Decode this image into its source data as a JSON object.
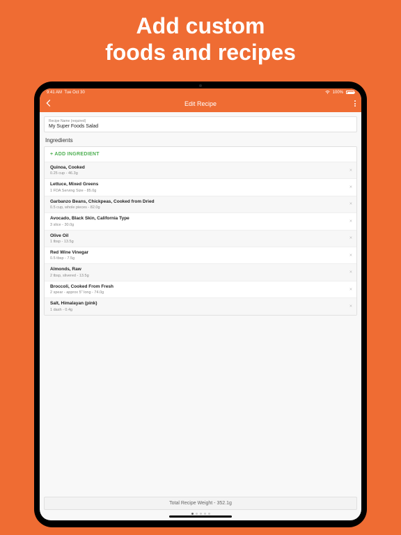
{
  "promo": {
    "line1": "Add custom",
    "line2": "foods and recipes"
  },
  "status": {
    "time": "9:41 AM",
    "date": "Tue Oct 30",
    "battery": "100%"
  },
  "nav": {
    "title": "Edit Recipe"
  },
  "recipe": {
    "label": "Recipe Name (required)",
    "name": "My Super Foods Salad"
  },
  "section": {
    "title": "Ingredients",
    "add": "+ ADD INGREDIENT"
  },
  "ingredients": [
    {
      "name": "Quinoa, Cooked",
      "amt": "0.25 cup - 46.3g"
    },
    {
      "name": "Lettuce, Mixed Greens",
      "amt": "1 FDA Serving Size - 85.0g"
    },
    {
      "name": "Garbanzo Beans, Chickpeas, Cooked from Dried",
      "amt": "0.5 cup, whole pieces - 82.0g"
    },
    {
      "name": "Avocado, Black Skin, California Type",
      "amt": "3 slice - 30.0g"
    },
    {
      "name": "Olive Oil",
      "amt": "1 tbsp - 13.5g"
    },
    {
      "name": "Red Wine Vinegar",
      "amt": "0.5 tbsp - 7.5g"
    },
    {
      "name": "Almonds, Raw",
      "amt": "2 tbsp, slivered - 13.5g"
    },
    {
      "name": "Broccoli, Cooked From Fresh",
      "amt": "2 spear - approx 5\" long - 74.0g"
    },
    {
      "name": "Salt, Himalayan (pink)",
      "amt": "1 dash - 0.4g"
    }
  ],
  "total": "Total Recipe Weight - 352.1g"
}
